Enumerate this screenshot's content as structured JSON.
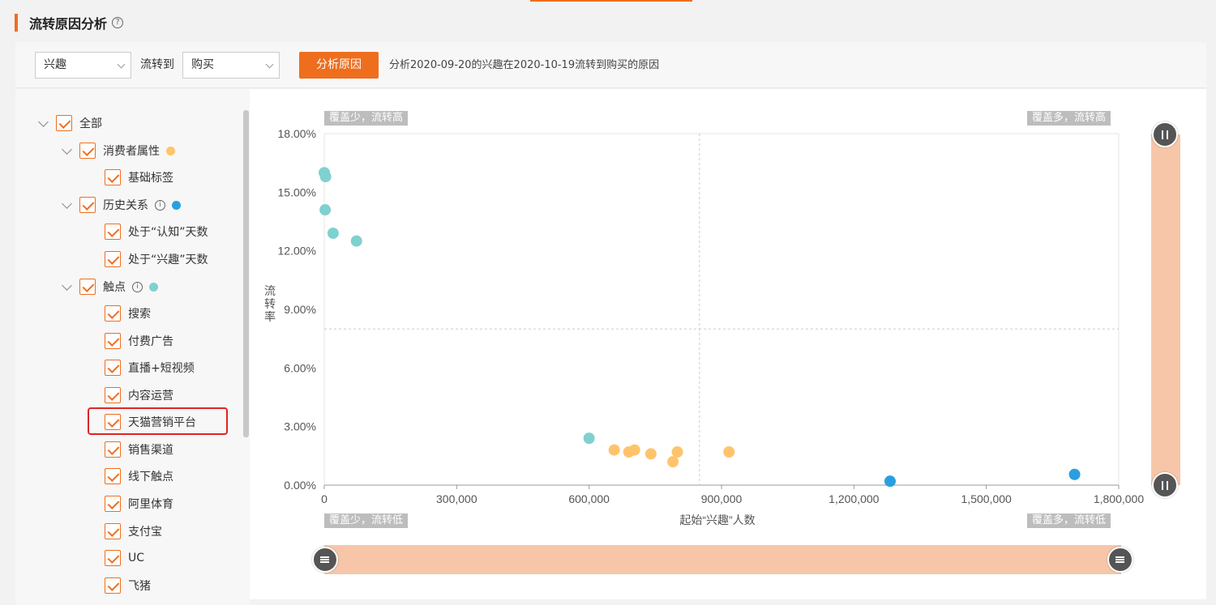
{
  "page": {
    "title": "流转原因分析",
    "help_icon": "?"
  },
  "toolbar": {
    "from_select": "兴趣",
    "to_label": "流转到",
    "to_select": "购买",
    "analyze_button": "分析原因",
    "description": "分析2020-09-20的兴趣在2020-10-19流转到购买的原因"
  },
  "tree": {
    "root": "全部",
    "groups": [
      {
        "label": "消费者属性",
        "dot_color": "#ffc46b",
        "children": [
          "基础标签"
        ]
      },
      {
        "label": "历史关系",
        "dot_color": "#2a9fdf",
        "children": [
          "处于“认知”天数",
          "处于“兴趣”天数"
        ]
      },
      {
        "label": "触点",
        "dot_color": "#7fd1cf",
        "children": [
          "搜索",
          "付费广告",
          "直播+短视频",
          "内容运营",
          "天猫营销平台",
          "销售渠道",
          "线下触点",
          "阿里体育",
          "支付宝",
          "UC",
          "飞猪"
        ]
      }
    ],
    "highlighted_item": "天猫营销平台"
  },
  "quadrant_labels": {
    "top_left": "覆盖少，流转高",
    "top_right": "覆盖多，流转高",
    "bottom_left": "覆盖少，流转低",
    "bottom_right": "覆盖多，流转低"
  },
  "chart_data": {
    "type": "scatter",
    "xlabel": "起始“兴趣”人数",
    "ylabel": "流转率",
    "xlim": [
      0,
      1800000
    ],
    "ylim": [
      0,
      18
    ],
    "x_ticks": [
      "0",
      "300,000",
      "600,000",
      "900,000",
      "1,200,000",
      "1,500,000",
      "1,800,000"
    ],
    "y_ticks": [
      "0.00%",
      "3.00%",
      "6.00%",
      "9.00%",
      "12.00%",
      "15.00%",
      "18.00%"
    ],
    "quadrant_split": {
      "x": 850000,
      "y": 8
    },
    "grid": false,
    "series": [
      {
        "color": "#7fd1cf",
        "points": [
          [
            0,
            16.0
          ],
          [
            3000,
            15.8
          ],
          [
            2000,
            14.1
          ],
          [
            20000,
            12.9
          ],
          [
            73000,
            12.5
          ],
          [
            600000,
            2.4
          ]
        ]
      },
      {
        "color": "#ffc46b",
        "points": [
          [
            657000,
            1.8
          ],
          [
            690000,
            1.7
          ],
          [
            703000,
            1.8
          ],
          [
            740000,
            1.6
          ],
          [
            790000,
            1.2
          ],
          [
            800000,
            1.7
          ],
          [
            917000,
            1.7
          ]
        ]
      },
      {
        "color": "#2a9fdf",
        "points": [
          [
            1282000,
            0.2
          ],
          [
            1700000,
            0.55
          ]
        ]
      }
    ]
  }
}
